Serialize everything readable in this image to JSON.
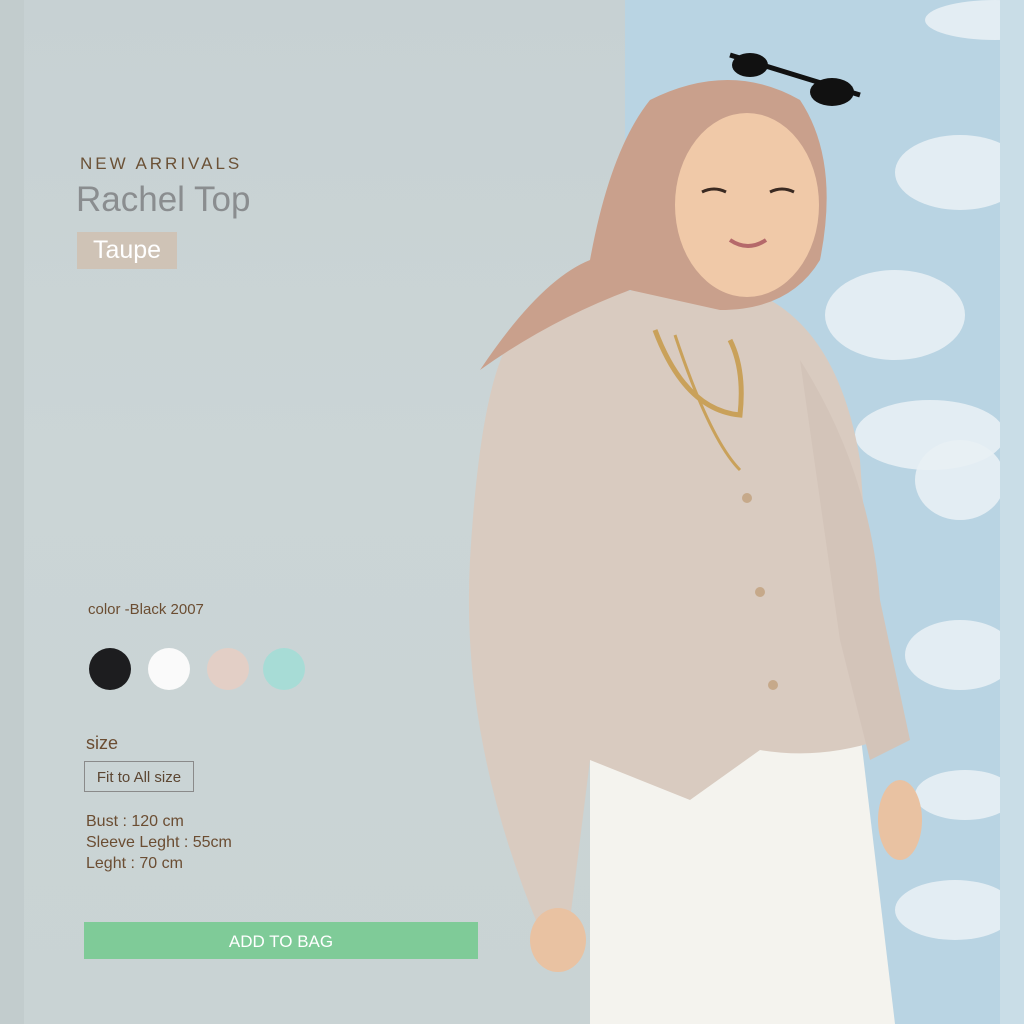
{
  "product": {
    "kicker": "NEW ARRIVALS",
    "name": "Rachel Top",
    "color_name": "Taupe"
  },
  "colors": {
    "label": "color  -Black 2007",
    "swatches": [
      {
        "name": "black",
        "hex": "#1d1d1f"
      },
      {
        "name": "white",
        "hex": "#fafafa"
      },
      {
        "name": "taupe",
        "hex": "#e3cfc6"
      },
      {
        "name": "mint",
        "hex": "#a7dcd6"
      }
    ]
  },
  "size": {
    "label": "size",
    "option": "Fit to All size"
  },
  "measurements": [
    "Bust : 120 cm",
    "Sleeve Leght : 55cm",
    "Leght : 70 cm"
  ],
  "actions": {
    "add_to_bag": "ADD TO BAG"
  },
  "theme": {
    "accent": "#7fcb98",
    "tag_bg": "#cfc3b6",
    "text_brown": "#6b4d32"
  }
}
